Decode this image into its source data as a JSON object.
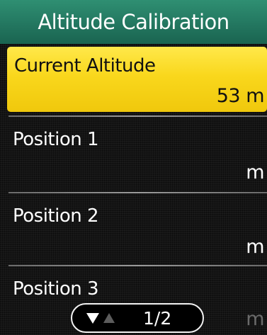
{
  "header": {
    "title": "Altitude Calibration",
    "bg_color": "#237760"
  },
  "rows": [
    {
      "label": "Current Altitude",
      "value": "53 m",
      "selected": true
    },
    {
      "label": "Position 1",
      "value": "m",
      "selected": false
    },
    {
      "label": "Position 2",
      "value": "m",
      "selected": false
    },
    {
      "label": "Position 3",
      "value": "m",
      "selected": false
    }
  ],
  "pager": {
    "page_text": "1/2",
    "down_icon": "triangle-down-icon",
    "up_icon": "triangle-up-icon"
  },
  "colors": {
    "selected_bg": "#f9d71c",
    "background": "#141414"
  }
}
